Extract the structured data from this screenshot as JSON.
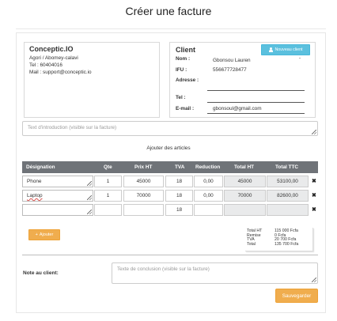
{
  "page": {
    "title": "Créer une facture"
  },
  "company": {
    "name": "Conceptic.IO",
    "address": "Agori / Abomey-calavi",
    "phone": "Tel : 60404016",
    "mail": "Mail : support@conceptic.io"
  },
  "client": {
    "title": "Client",
    "new_button": "Nouveau client",
    "labels": {
      "nom": "Nom :",
      "ifu": "IFU :",
      "adresse": "Adresse :",
      "tel": "Tel :",
      "email": "E-mail :"
    },
    "values": {
      "nom": "Gbonsou Lauren",
      "ifu": "556677728477",
      "adresse": "",
      "tel": "",
      "email": "gbonsoul@gmail.com"
    }
  },
  "intro": {
    "placeholder": "Text d'introduction (visible sur la facture)"
  },
  "articles": {
    "title": "Ajouter des articles",
    "headers": [
      "Désignation",
      "Qte",
      "Prix HT",
      "TVA",
      "Reduction",
      "Total HT",
      "Total TTC"
    ],
    "rows": [
      {
        "designation": "Phone",
        "qte": "1",
        "prix": "45000",
        "tva": "18",
        "reduction": "0,00",
        "total_ht": "45000",
        "total_ttc": "53100,00"
      },
      {
        "designation": "Laptop",
        "qte": "1",
        "prix": "70000",
        "tva": "18",
        "reduction": "0,00",
        "total_ht": "70000",
        "total_ttc": "82600,00"
      },
      {
        "designation": "",
        "qte": "",
        "prix": "",
        "tva": "18",
        "reduction": "",
        "total_ht": "",
        "total_ttc": ""
      }
    ],
    "delete_glyph": "✖",
    "add_button": "Ajouter"
  },
  "totals": [
    {
      "label": "Total HT",
      "value": "115 000 Fcfa"
    },
    {
      "label": "Remise",
      "value": "0 Fcfa"
    },
    {
      "label": "TVA",
      "value": "20 700 Fcfa"
    },
    {
      "label": "Total",
      "value": "135 700 Fcfa"
    }
  ],
  "note": {
    "label": "Note au client:",
    "placeholder": "Texte de conclusion (visible sur la facture)"
  },
  "save_button": "Sauvegarder",
  "colors": {
    "info": "#5bc0de",
    "warning": "#f0ad4e",
    "table_header": "#6f7378"
  }
}
